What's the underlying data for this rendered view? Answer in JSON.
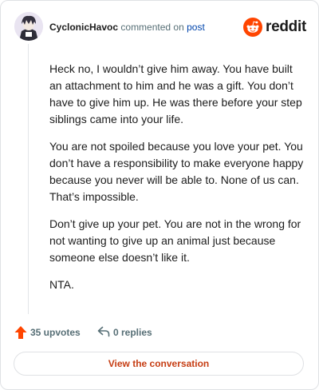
{
  "header": {
    "username": "CyclonicHavoc",
    "action_text": "commented on",
    "post_link": "post",
    "brand": "reddit"
  },
  "comment": {
    "paragraphs": [
      "Heck no, I wouldn’t give him away. You have built an attachment to him and he was a gift. You don’t have to give him up. He was there before your step siblings came into your life.",
      "You are not spoiled because you love your pet. You don’t have a responsibility to make everyone happy because you never will be able to. None of us can. That’s impossible.",
      "Don’t give up your pet. You are not in the wrong for not wanting to give up an animal just because someone else doesn’t like it.",
      "NTA."
    ]
  },
  "actions": {
    "upvotes": "35 upvotes",
    "replies": "0 replies"
  },
  "cta": {
    "label": "View the conversation"
  },
  "colors": {
    "brand": "#ff4500",
    "upvote": "#ff4500",
    "link": "#0045ac",
    "cta_text": "#c63d13"
  },
  "icons": [
    "avatar",
    "reddit-logo-icon",
    "upvote-icon",
    "reply-icon"
  ]
}
